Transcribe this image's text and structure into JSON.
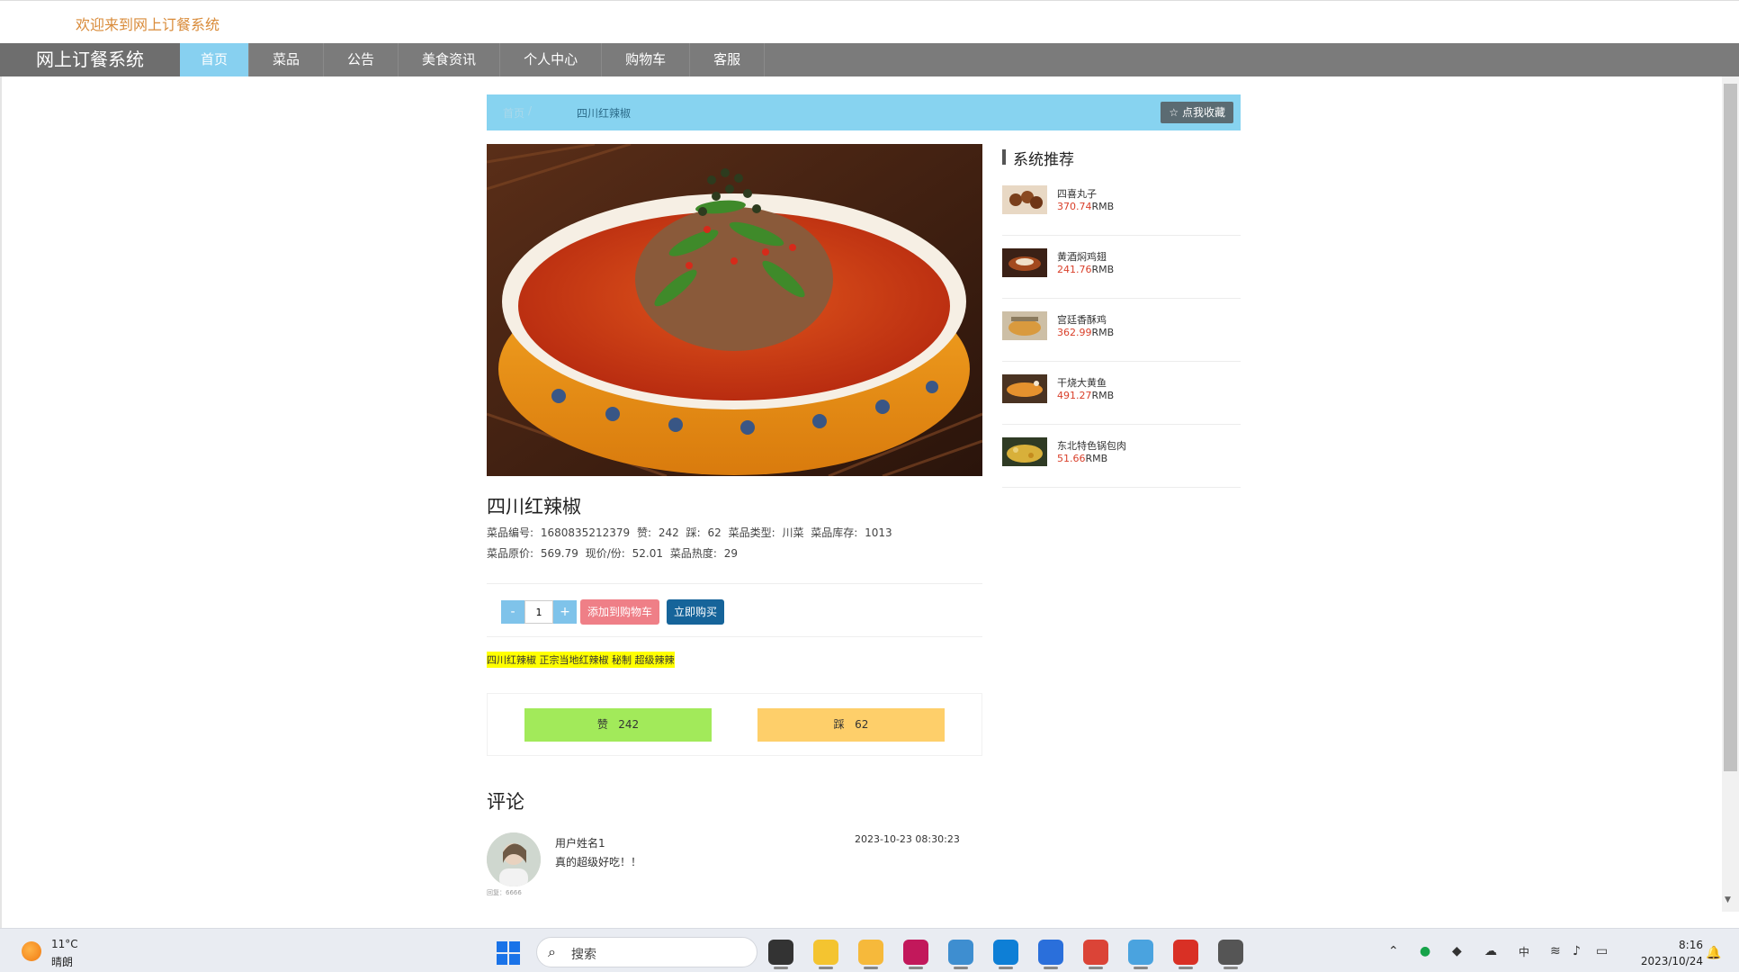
{
  "header": {
    "welcome": "欢迎来到网上订餐系统"
  },
  "nav": {
    "brand": "网上订餐系统",
    "items": [
      {
        "label": "首页",
        "active": true
      },
      {
        "label": "菜品"
      },
      {
        "label": "公告"
      },
      {
        "label": "美食资讯"
      },
      {
        "label": "个人中心"
      },
      {
        "label": "购物车"
      },
      {
        "label": "客服"
      }
    ]
  },
  "breadcrumb": {
    "home": "首页",
    "separator": "/",
    "current": "四川红辣椒",
    "favorite_label": "☆ 点我收藏"
  },
  "dish": {
    "title": "四川红辣椒",
    "code_label": "菜品编号:",
    "code": "1680835212379",
    "likes_label": "赞:",
    "likes": "242",
    "dislikes_label": "踩:",
    "dislikes": "62",
    "type_label": "菜品类型:",
    "type": "川菜",
    "stock_label": "菜品库存:",
    "stock": "1013",
    "original_price_label": "菜品原价:",
    "original_price": "569.79",
    "current_price_label": "现价/份:",
    "current_price": "52.01",
    "heat_label": "菜品热度:",
    "heat": "29",
    "tagline": "四川红辣椒 正宗当地红辣椒 秘制 超级辣辣"
  },
  "purchase": {
    "minus": "-",
    "plus": "+",
    "quantity": "1",
    "add_cart": "添加到购物车",
    "buy_now": "立即购买"
  },
  "votes": {
    "like_label": "赞",
    "like_count": "242",
    "dislike_label": "踩",
    "dislike_count": "62"
  },
  "comments": {
    "title": "评论",
    "items": [
      {
        "user": "用户姓名1",
        "text": "真的超级好吃！！",
        "time": "2023-10-23 08:30:23",
        "avatar_caption": "回复：6666"
      }
    ]
  },
  "recommendations": {
    "title": "系统推荐",
    "currency": "RMB",
    "items": [
      {
        "name": "四喜丸子",
        "price": "370.74"
      },
      {
        "name": "黄酒焖鸡翅",
        "price": "241.76"
      },
      {
        "name": "宫廷香酥鸡",
        "price": "362.99"
      },
      {
        "name": "干烧大黄鱼",
        "price": "491.27"
      },
      {
        "name": "东北特色锅包肉",
        "price": "51.66"
      }
    ]
  },
  "taskbar": {
    "weather_temp": "11°C",
    "weather_desc": "晴朗",
    "search_placeholder": "搜索",
    "time": "8:16",
    "date": "2023/10/24",
    "input_method": "中",
    "apps": [
      {
        "name": "task-view-icon",
        "color": "#333333"
      },
      {
        "name": "browser-app-icon",
        "color": "#f4c430"
      },
      {
        "name": "file-explorer-icon",
        "color": "#f6b93b"
      },
      {
        "name": "ide-app-icon",
        "color": "#c2185b"
      },
      {
        "name": "gallery-app-icon",
        "color": "#3e8ed0"
      },
      {
        "name": "edge-icon",
        "color": "#0e7fd6"
      },
      {
        "name": "notepad-icon",
        "color": "#2a6fdb"
      },
      {
        "name": "chrome-icon",
        "color": "#db4437"
      },
      {
        "name": "cloud-app-icon",
        "color": "#4aa3df"
      },
      {
        "name": "wps-icon",
        "color": "#d93025"
      },
      {
        "name": "media-app-icon",
        "color": "#555555"
      }
    ]
  }
}
